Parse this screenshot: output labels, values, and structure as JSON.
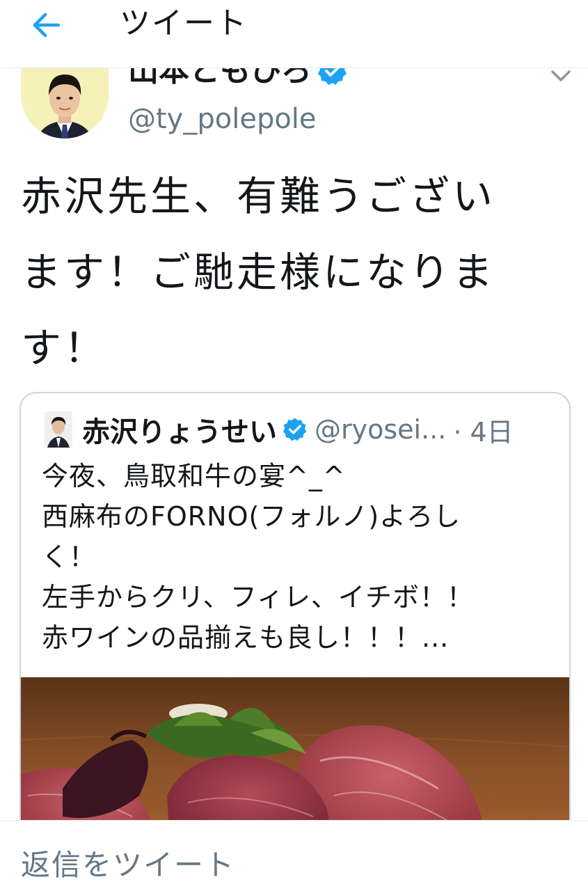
{
  "header": {
    "title": "ツイート",
    "back_icon": "arrow-left-icon",
    "accent_color": "#1da1f2"
  },
  "author": {
    "display_name": "山本ともひろ",
    "handle": "@ty_polepole",
    "verified_icon": "verified-badge-icon",
    "menu_icon": "chevron-down-icon"
  },
  "tweet": {
    "text_lines": [
      "赤沢先生、有難うござい",
      "ます！ご馳走様になりま",
      "す！"
    ]
  },
  "quote": {
    "name": "赤沢りょうせい",
    "handle": "@ryosei...",
    "time": "· 4日",
    "text_lines": [
      "今夜、鳥取和牛の宴^_^",
      "西麻布のFORNO(フォルノ)よろし",
      "く！",
      "左手からクリ、フィレ、イチボ！！",
      "赤ワインの品揃えも良し！！！..."
    ],
    "image_subject": "wagyu-beef-platter"
  },
  "reply": {
    "placeholder": "返信をツイート"
  }
}
